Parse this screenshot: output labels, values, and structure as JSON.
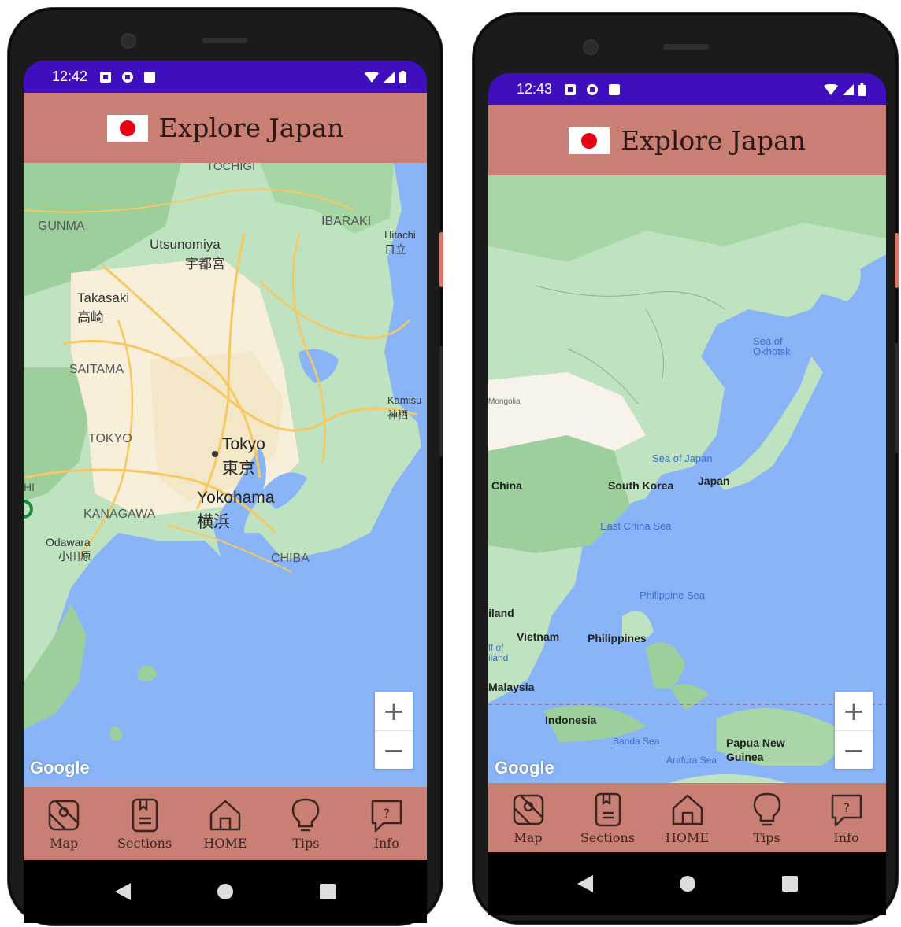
{
  "phones": [
    {
      "status": {
        "time": "12:42"
      },
      "app_bar": {
        "title": "Explore Japan"
      },
      "map": {
        "labels": [
          "TOCHIGI",
          "GUNMA",
          "IBARAKI",
          "Utsunomiya",
          "宇都宮",
          "Hitachi",
          "日立",
          "Takasaki",
          "高崎",
          "SAITAMA",
          "Kamisu",
          "神栖",
          "TOKYO",
          "Tokyo",
          "東京",
          "Yokohama",
          "横浜",
          "KANAGAWA",
          "Odawara",
          "小田原",
          "CHIBA",
          "HI"
        ],
        "attribution": "Google",
        "zoom_in": "+",
        "zoom_out": "−"
      },
      "nav": [
        {
          "label": "Map"
        },
        {
          "label": "Sections"
        },
        {
          "label": "HOME"
        },
        {
          "label": "Tips"
        },
        {
          "label": "Info"
        }
      ]
    },
    {
      "status": {
        "time": "12:43"
      },
      "app_bar": {
        "title": "Explore Japan"
      },
      "map": {
        "labels": [
          "Mongolia",
          "Sea of Okhotsk",
          "Sea of Japan",
          "China",
          "South Korea",
          "Japan",
          "East China Sea",
          "Philippine Sea",
          "iland",
          "Vietnam",
          "Philippines",
          "lf of iland",
          "Malaysia",
          "Indonesia",
          "Banda Sea",
          "Papua New Guinea",
          "Arafura Sea"
        ],
        "attribution": "Google",
        "zoom_in": "+",
        "zoom_out": "−"
      },
      "nav": [
        {
          "label": "Map"
        },
        {
          "label": "Sections"
        },
        {
          "label": "HOME"
        },
        {
          "label": "Tips"
        },
        {
          "label": "Info"
        }
      ]
    }
  ],
  "colors": {
    "status_bar": "#3f0fbd",
    "app_bar": "#c97f74",
    "water": "#8ab4f8",
    "land": "#bfe3c0",
    "forest": "#9ccf9c",
    "urban": "#f7efd9",
    "road": "#f7c85f",
    "flag_red": "#e60012"
  }
}
